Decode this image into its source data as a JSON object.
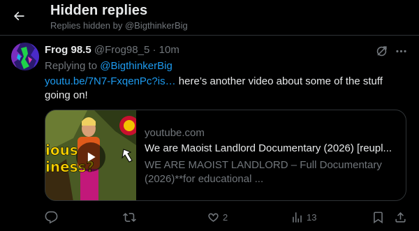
{
  "header": {
    "title": "Hidden replies",
    "subtitle": "Replies hidden by @BigthinkerBig"
  },
  "tweet": {
    "display_name": "Frog 98.5",
    "handle": "@Frog98_5",
    "separator": "·",
    "time": "10m",
    "replying_prefix": "Replying to",
    "replying_handle": "@BigthinkerBig",
    "link_text": "youtu.be/7N7-FxqenPc?is…",
    "body_text": " here’s another video about some of the stuff going on!",
    "card": {
      "domain": "youtube.com",
      "title": "We are Maoist Landlord Documentary (2026) [reupl...",
      "description": "WE ARE MAOIST LANDLORD – Full Documentary (2026)**for educational ..."
    },
    "actions": {
      "reply_count": "",
      "retweet_count": "",
      "like_count": "2",
      "view_count": "13"
    }
  },
  "colors": {
    "background": "#000000",
    "text_primary": "#e7e9ea",
    "text_secondary": "#71767b",
    "link": "#1d9bf0",
    "border": "#2f3336"
  },
  "icons": [
    "arrow-left-icon",
    "hide-reply-icon",
    "more-icon",
    "reply-icon",
    "retweet-icon",
    "like-icon",
    "views-icon",
    "bookmark-icon",
    "share-icon",
    "play-icon"
  ]
}
